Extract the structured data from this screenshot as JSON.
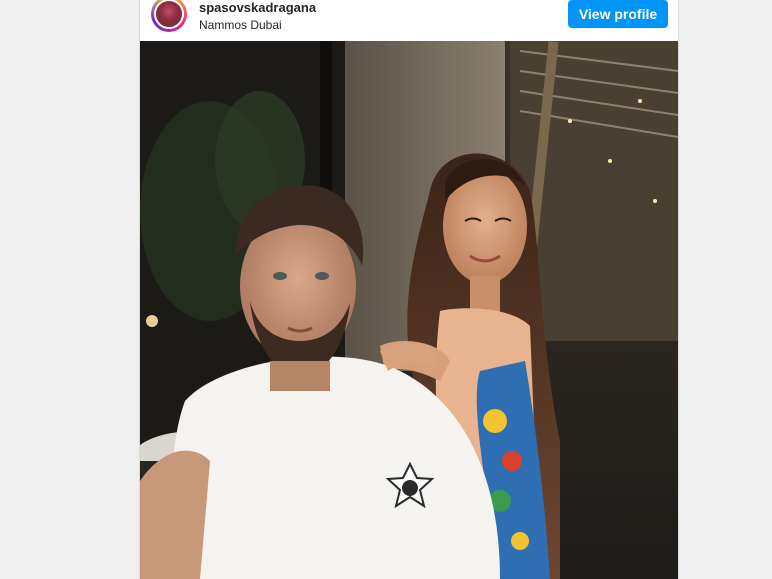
{
  "post": {
    "username": "spasovskadragana",
    "location": "Nammos Dubai",
    "view_profile_label": "View profile"
  },
  "colors": {
    "page_background": "#efefef",
    "embed_background": "#ffffff",
    "button_blue": "#0095f6",
    "text_dark": "#262626"
  },
  "icons": {
    "avatar": "profile-avatar-icon"
  }
}
